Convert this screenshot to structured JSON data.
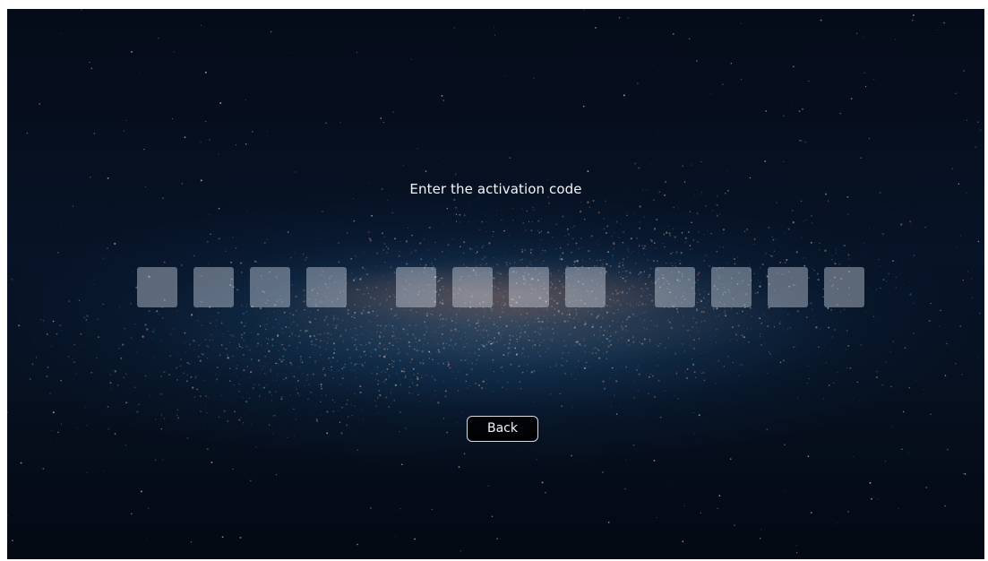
{
  "screen": {
    "prompt": "Enter the activation code",
    "back_label": "Back"
  },
  "code": {
    "groups": [
      [
        "",
        "",
        "",
        ""
      ],
      [
        "",
        "",
        "",
        ""
      ],
      [
        "",
        "",
        "",
        ""
      ]
    ]
  },
  "colors": {
    "background": "#071326",
    "cell": "#d2dae4",
    "text": "#f2f4f7",
    "button_border": "#d8dbe0"
  }
}
